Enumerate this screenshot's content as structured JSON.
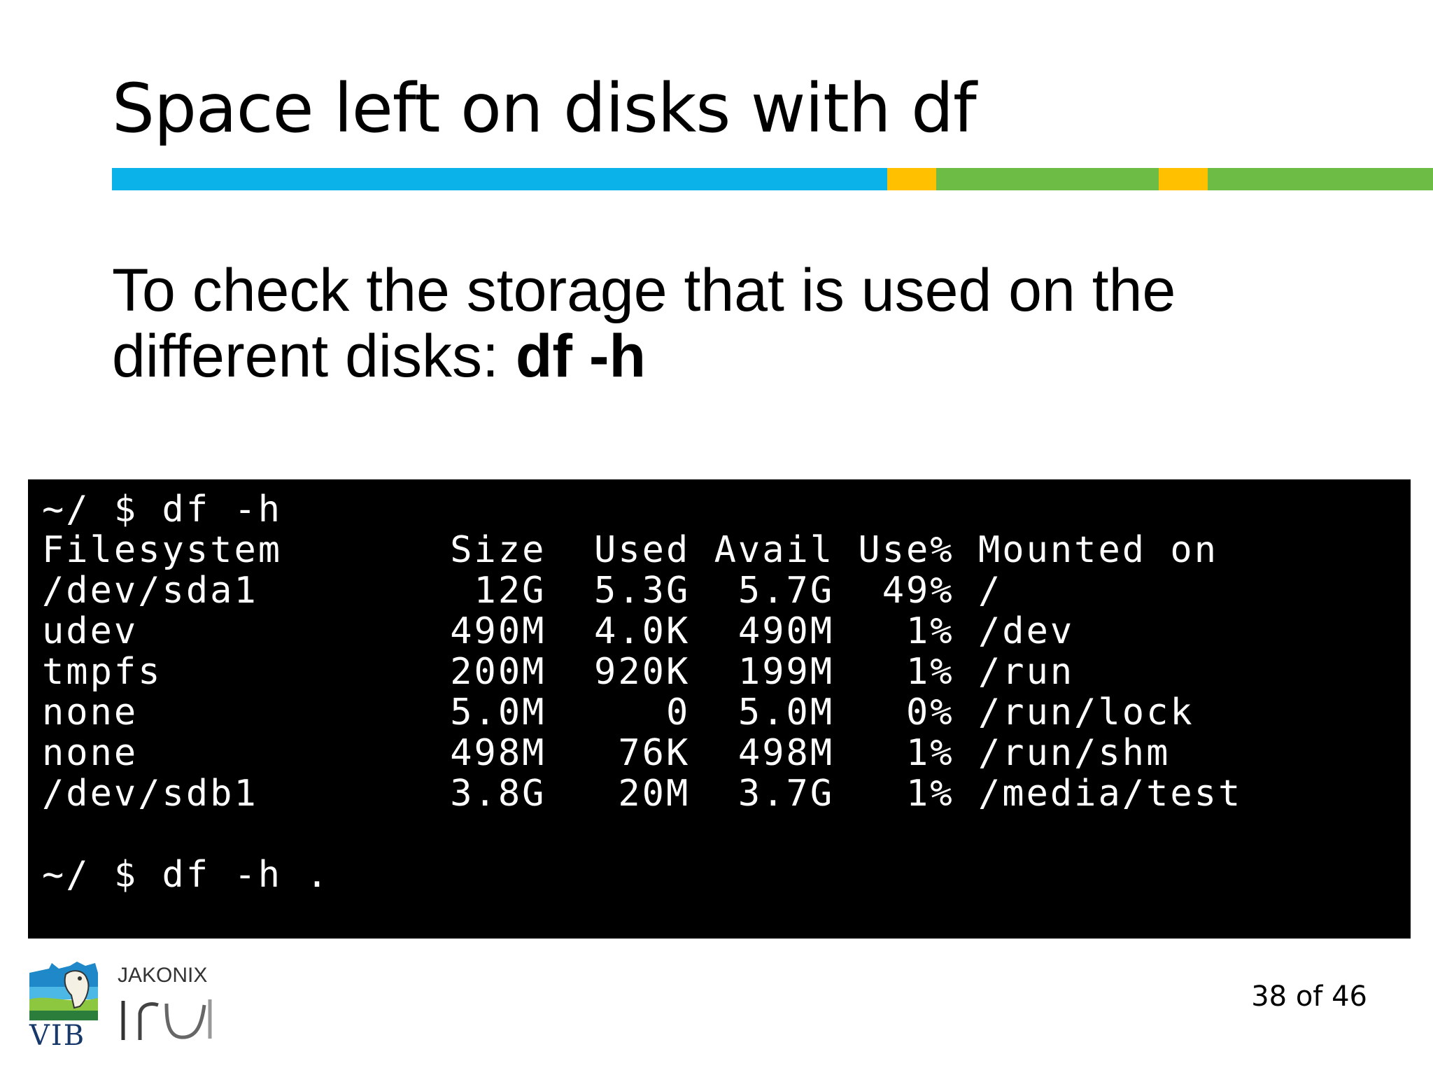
{
  "slide": {
    "title": "Space left on disks with df",
    "body_text": "To check the storage that is used on the different disks: ",
    "body_command": "df -h",
    "page_number": "38 of 46"
  },
  "color_bar": {
    "colors": [
      "#0bb1e9",
      "#ffc000",
      "#6cbc45",
      "#ffc000",
      "#6cbc45"
    ]
  },
  "terminal": {
    "lines": [
      "~/ $ df -h",
      "Filesystem       Size  Used Avail Use% Mounted on",
      "/dev/sda1         12G  5.3G  5.7G  49% /",
      "udev             490M  4.0K  490M   1% /dev",
      "tmpfs            200M  920K  199M   1% /run",
      "none             5.0M     0  5.0M   0% /run/lock",
      "none             498M   76K  498M   1% /run/shm",
      "/dev/sdb1        3.8G   20M  3.7G   1% /media/test",
      "",
      "~/ $ df -h ."
    ]
  },
  "footer": {
    "vib_logo_text": "VIB",
    "partner_logo_text": "JAKONIX",
    "partner_logo_name": "iru-logo"
  }
}
